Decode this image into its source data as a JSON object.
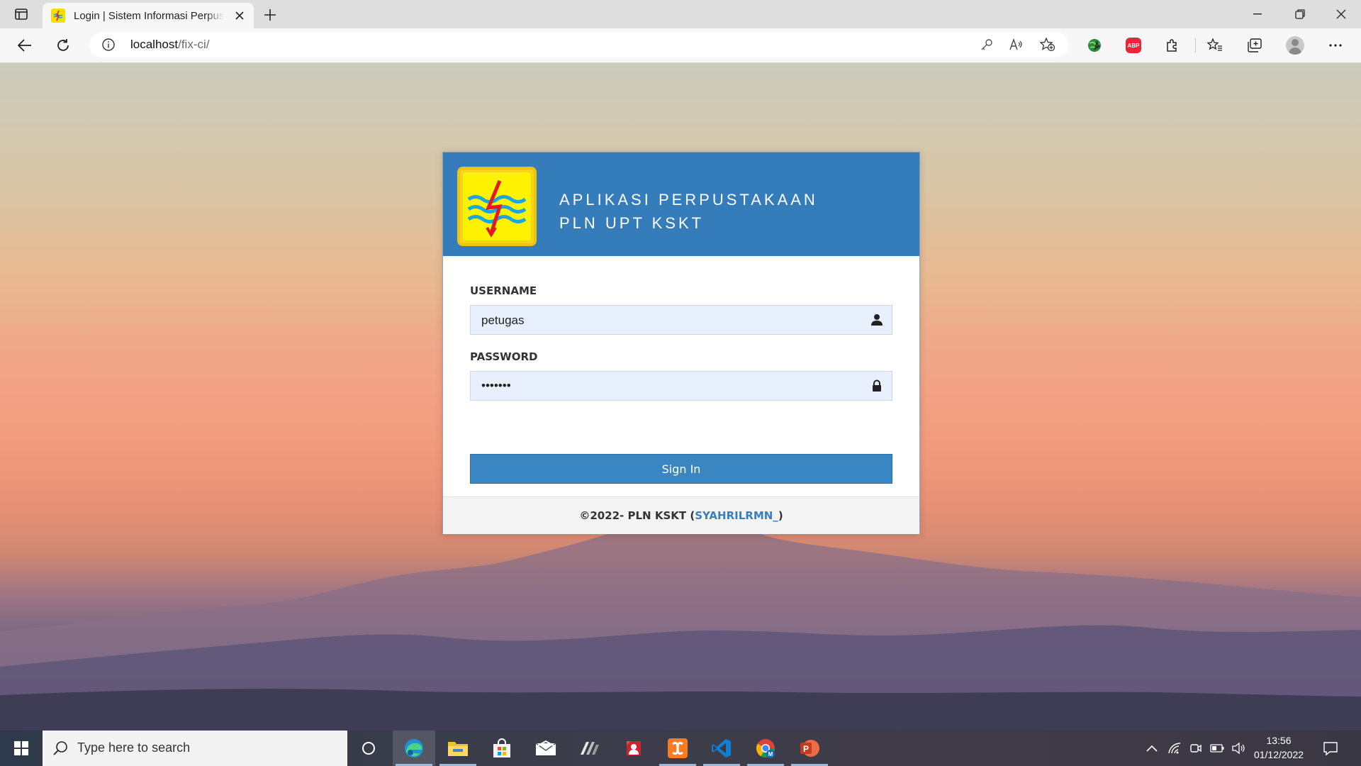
{
  "browser": {
    "tab_title": "Login | Sistem Informasi Perpustakaan",
    "url_host": "localhost",
    "url_path": "/fix-ci/",
    "extensions": [
      "key-icon",
      "read-aloud-icon",
      "add-favorite-icon",
      "globe-extension-icon",
      "adblock-plus-icon",
      "extensions-icon",
      "favorites-icon",
      "collections-icon",
      "profile-avatar",
      "more-icon"
    ],
    "abp_label": "ABP"
  },
  "login": {
    "title_line1": "APLIKASI PERPUSTAKAAN",
    "title_line2": "PLN UPT KSKT",
    "username_label": "USERNAME",
    "username_value": "petugas",
    "password_label": "PASSWORD",
    "password_value": "•••••••",
    "signin_label": "Sign In",
    "footer_text": "©2022- PLN KSKT (",
    "footer_author": "SYAHRILRMN_",
    "footer_close": ")"
  },
  "taskbar": {
    "search_placeholder": "Type here to search",
    "apps": [
      "cortana-icon",
      "edge-icon",
      "file-explorer-icon",
      "store-icon",
      "mail-icon",
      "app-stripes-icon",
      "app-red-icon",
      "xampp-icon",
      "vscode-icon",
      "chrome-icon",
      "powerpoint-icon"
    ],
    "time": "13:56",
    "date": "01/12/2022"
  },
  "colors": {
    "header_blue": "#357cba",
    "signin_blue": "#3a86c2",
    "author_link": "#3a7fbd",
    "logo_yellow": "#fff200"
  }
}
